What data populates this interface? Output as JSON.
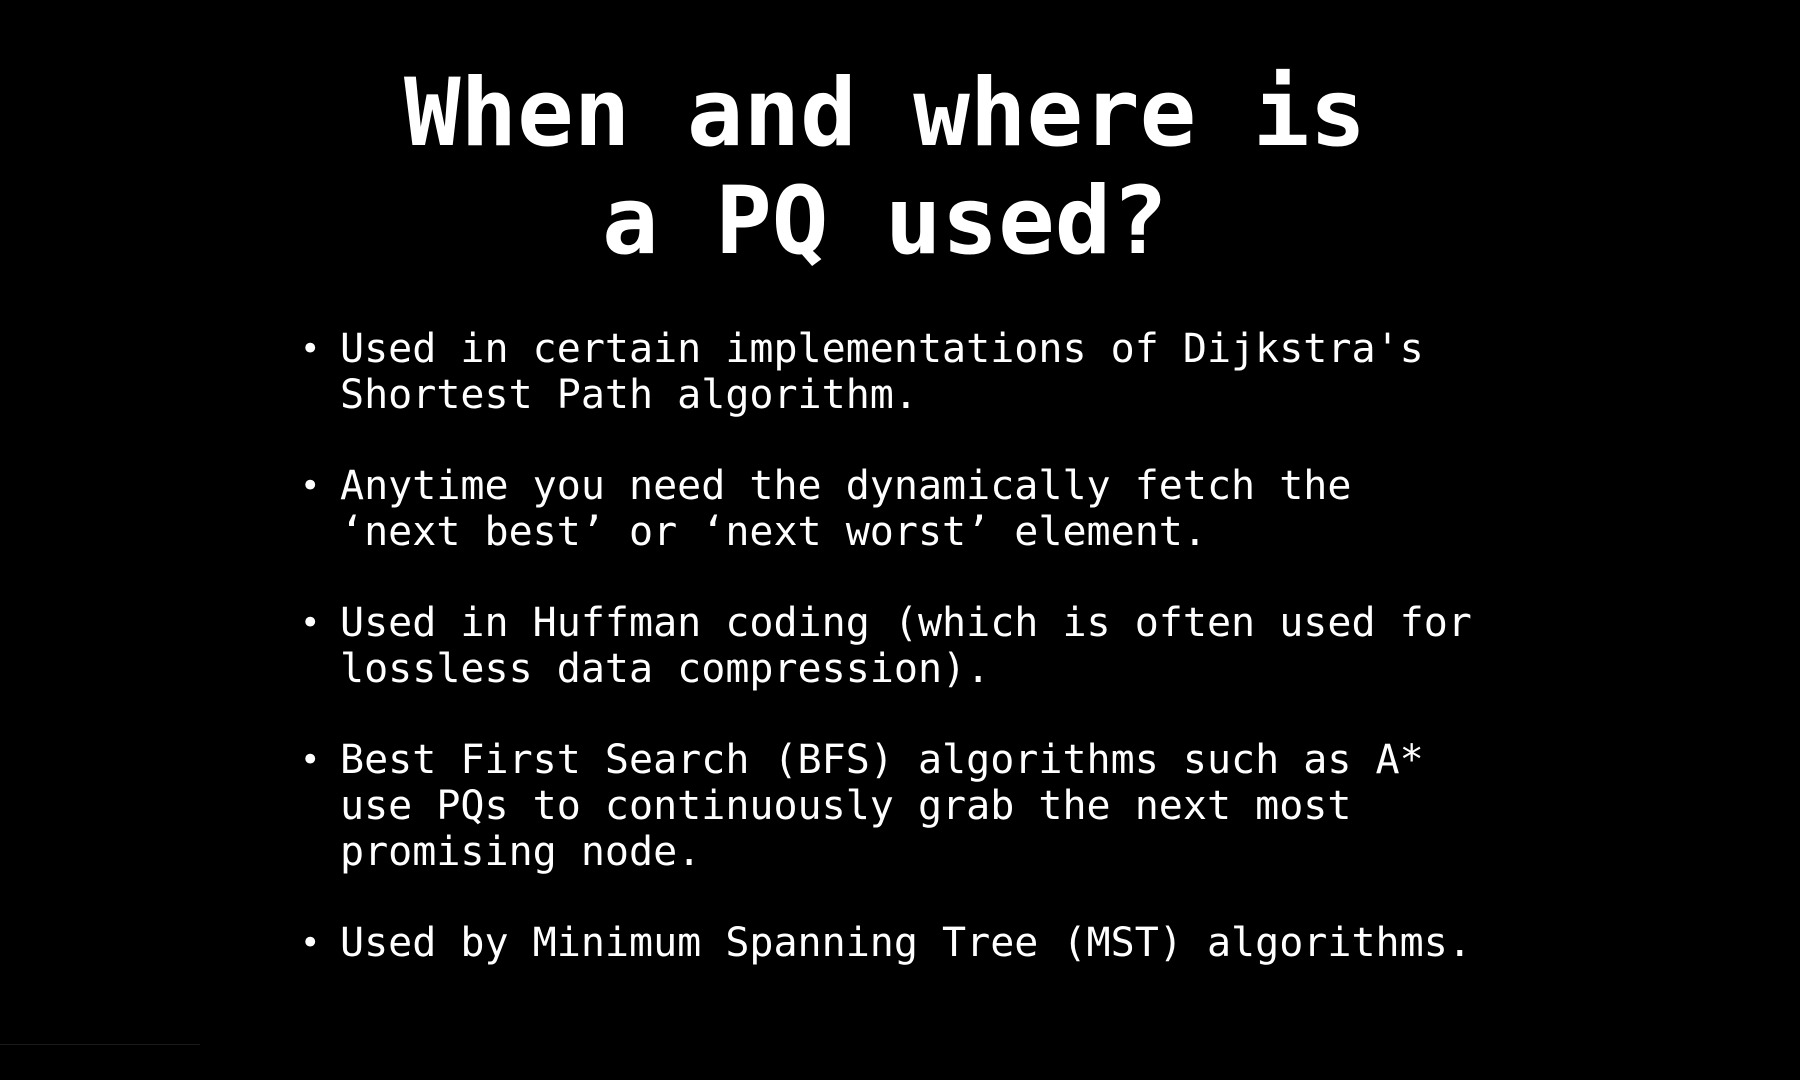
{
  "slide": {
    "title_lines": [
      "When and where is",
      "a PQ used?"
    ],
    "bullet_marker": "•",
    "bullets": [
      {
        "lines": [
          "Used in certain implementations of Dijkstra's",
          "Shortest Path algorithm."
        ]
      },
      {
        "lines": [
          "Anytime you need the dynamically fetch the",
          "‘next best’ or ‘next worst’ element."
        ]
      },
      {
        "lines": [
          "Used in Huffman coding (which is often used for",
          "lossless data compression)."
        ]
      },
      {
        "lines": [
          "Best First Search (BFS) algorithms such as A*",
          "use PQs to continuously grab the next most",
          "promising node."
        ]
      },
      {
        "lines": [
          "Used by Minimum Spanning Tree (MST) algorithms."
        ]
      }
    ]
  },
  "colors": {
    "background": "#000000",
    "text": "#ffffff"
  }
}
